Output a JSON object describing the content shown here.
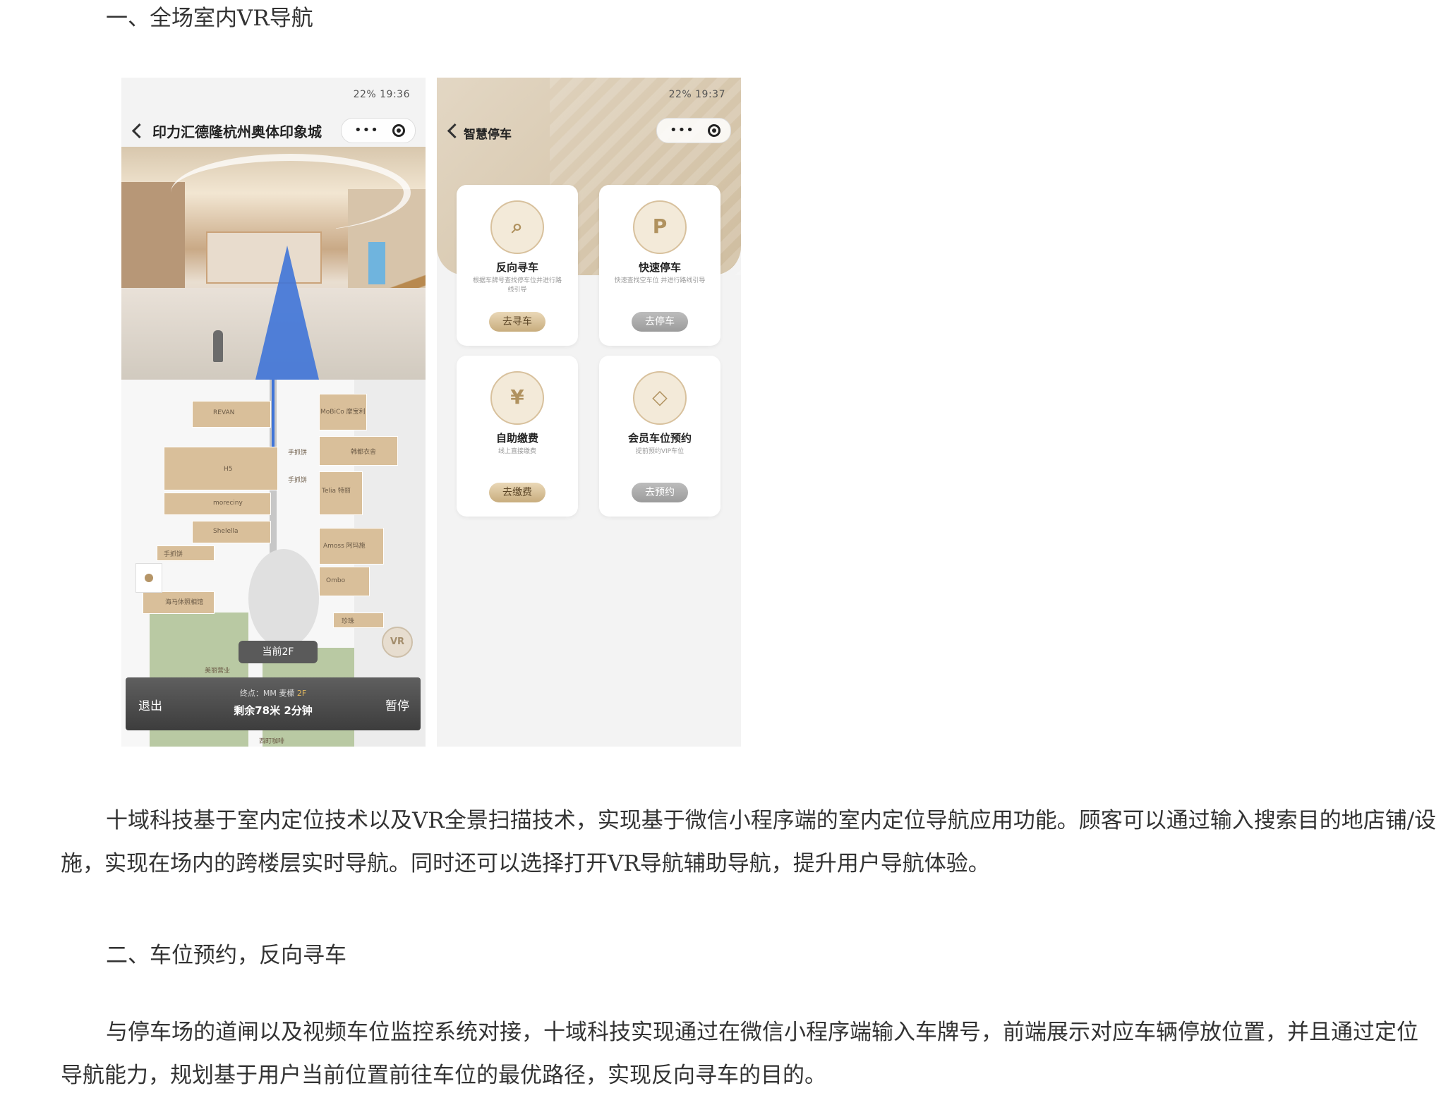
{
  "section1": {
    "heading": "一、全场室内VR导航"
  },
  "phone1": {
    "status": "19:36",
    "status_battery": "22%",
    "title": "印力汇德隆杭州奥体印象城",
    "map_labels": [
      "REVAN",
      "MoBiCo 摩宝利",
      "手抓饼",
      "韩都衣舍",
      "H5",
      "moreciny",
      "Shelella",
      "手抓饼",
      "Telia 特丽",
      "Amoss 阿玛施",
      "Ombo",
      "海马体照相馆",
      "手抓饼",
      "珍珠",
      "美丽营业",
      "西町咖啡"
    ],
    "floor_tag": "当前2F",
    "exit_label": "退出",
    "pause_label": "暂停",
    "destination": "终点：MM 麦檬",
    "destination_floor": "2F",
    "remaining": "剩余78米 2分钟",
    "vr_badge": "VR",
    "icons": [
      "back-icon",
      "more-icon",
      "target-icon",
      "locate-icon",
      "vr-icon"
    ]
  },
  "phone2": {
    "status": "19:37",
    "status_battery": "22%",
    "title": "智慧停车",
    "cards": [
      {
        "title": "反向寻车",
        "desc": "根据车牌号查找停车位并进行路线引导",
        "button": "去寻车",
        "icon": "car-search-icon",
        "glyph": "⌕"
      },
      {
        "title": "快速停车",
        "desc": "快速查找空车位 并进行路线引导",
        "button": "去停车",
        "icon": "parking-icon",
        "glyph": "P"
      },
      {
        "title": "自助缴费",
        "desc": "线上直接缴费",
        "button": "去缴费",
        "icon": "payment-icon",
        "glyph": "¥"
      },
      {
        "title": "会员车位预约",
        "desc": "提前预约VIP车位",
        "button": "去预约",
        "icon": "diamond-icon",
        "glyph": "◇"
      }
    ]
  },
  "paragraph1": "十域科技基于室内定位技术以及VR全景扫描技术，实现基于微信小程序端的室内定位导航应用功能。顾客可以通过输入搜索目的地店铺/设施，实现在场内的跨楼层实时导航。同时还可以选择打开VR导航辅助导航，提升用户导航体验。",
  "section2": {
    "heading": "二、车位预约，反向寻车"
  },
  "paragraph2": "与停车场的道闸以及视频车位监控系统对接，十域科技实现通过在微信小程序端输入车牌号，前端展示对应车辆停放位置，并且通过定位导航能力，规划基于用户当前位置前往车位的最优路径，实现反向寻车的目的。"
}
